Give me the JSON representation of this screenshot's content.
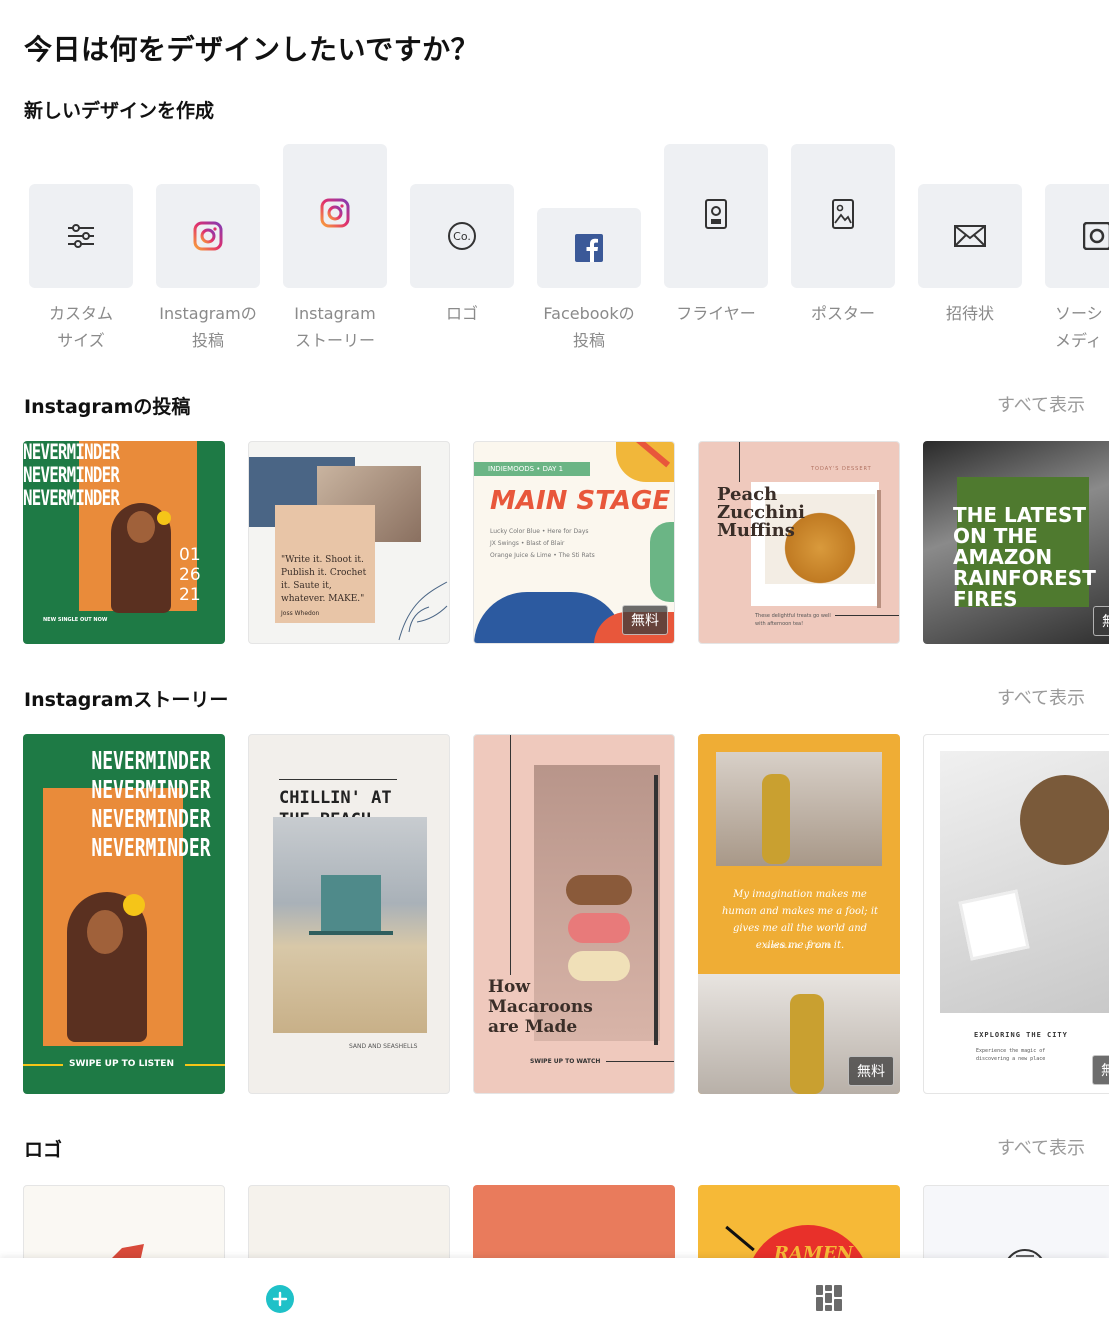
{
  "header": {
    "title": "今日は何をデザインしたいですか？"
  },
  "create_section": {
    "label": "新しいデザインを作成",
    "items": [
      {
        "label": "カスタム\nサイズ",
        "icon": "sliders-icon"
      },
      {
        "label": "Instagramの\n投稿",
        "icon": "instagram-icon"
      },
      {
        "label": "Instagram\nストーリー",
        "icon": "instagram-icon"
      },
      {
        "label": "ロゴ",
        "icon": "logo-co-icon"
      },
      {
        "label": "Facebookの\n投稿",
        "icon": "facebook-icon"
      },
      {
        "label": "フライヤー",
        "icon": "flyer-icon"
      },
      {
        "label": "ポスター",
        "icon": "poster-icon"
      },
      {
        "label": "招待状",
        "icon": "invitation-icon"
      },
      {
        "label": "ソーシ\nメディ",
        "icon": "social-media-icon"
      }
    ]
  },
  "sections": {
    "instagram_post": {
      "label": "Instagramの投稿",
      "see_all": "すべて表示",
      "cards": {
        "c1": {
          "lines": [
            "NEVERMINDER",
            "NEVERMINDER",
            "NEVERMINDER"
          ],
          "date": [
            "01",
            "26",
            "21"
          ],
          "footer": "NEW SINGLE OUT NOW"
        },
        "c2": {
          "quote": "\"Write it. Shoot it. Publish it. Crochet it. Saute it, whatever. MAKE.\"",
          "author": "Joss Whedon"
        },
        "c3": {
          "tag": "INDIEMOODS • DAY 1",
          "title": "MAIN STAGE",
          "lines": [
            "Lucky Color Blue • Here for Days",
            "JX Swings • Blast of Blair",
            "Orange Juice & Lime • The Sti Rats"
          ],
          "badge": "無料"
        },
        "c4": {
          "small": "TODAY'S DESSERT",
          "title": "Peach\nZucchini\nMuffins",
          "caption": "These delightful treats go well with afternoon tea!"
        },
        "c5": {
          "title": "THE LATEST\nON THE\nAMAZON\nRAINFOREST\nFIRES",
          "badge": "無料"
        }
      }
    },
    "instagram_story": {
      "label": "Instagramストーリー",
      "see_all": "すべて表示",
      "cards": {
        "c1": {
          "lines": [
            "NEVERMINDER",
            "NEVERMINDER",
            "NEVERMINDER",
            "NEVERMINDER"
          ],
          "footer": "SWIPE UP TO LISTEN"
        },
        "c2": {
          "title": "CHILLIN' AT\nTHE BEACH",
          "footer": "SAND AND SEASHELLS"
        },
        "c3": {
          "title": "How\nMacaroons\nare Made",
          "footer": "SWIPE UP TO WATCH"
        },
        "c4": {
          "quote": "My imagination makes me human and makes me a fool; it gives me all the world and exiles me from it.",
          "author": "URSULA K. LE GUIN",
          "badge": "無料"
        },
        "c5": {
          "title": "EXPLORING THE CITY",
          "caption": "Experience the magic of discovering a new place",
          "badge": "無料"
        }
      }
    },
    "logo": {
      "label": "ロゴ",
      "see_all": "すべて表示",
      "cards": {
        "c4": {
          "text": "RAMEN"
        }
      }
    }
  },
  "bottom_bar": {
    "create_icon": "plus-circle-icon",
    "templates_icon": "grid-icon"
  },
  "colors": {
    "accent": "#1fc1c8",
    "green": "#1e7a45",
    "orange": "#e98b3a",
    "tile_bg": "#eef0f3"
  }
}
